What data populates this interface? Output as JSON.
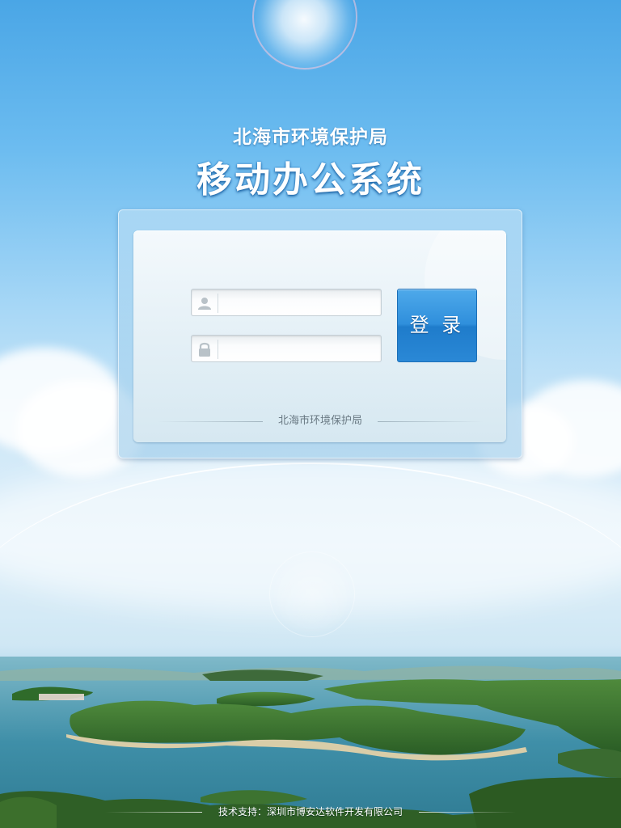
{
  "header": {
    "org_title": "北海市环境保护局",
    "system_title": "移动办公系统"
  },
  "login": {
    "username_placeholder": "",
    "password_placeholder": "",
    "username_icon": "user-icon",
    "password_icon": "lock-icon",
    "submit_label": "登 录",
    "footer_label": "北海市环境保护局"
  },
  "footer": {
    "credit": "技术支持：深圳市博安达软件开发有限公司"
  },
  "colors": {
    "sky": "#4aa6e6",
    "button": "#2f8fdc",
    "panel": "#e6f1f7",
    "water": "#3c8aa2",
    "forest": "#2f6b2a"
  }
}
